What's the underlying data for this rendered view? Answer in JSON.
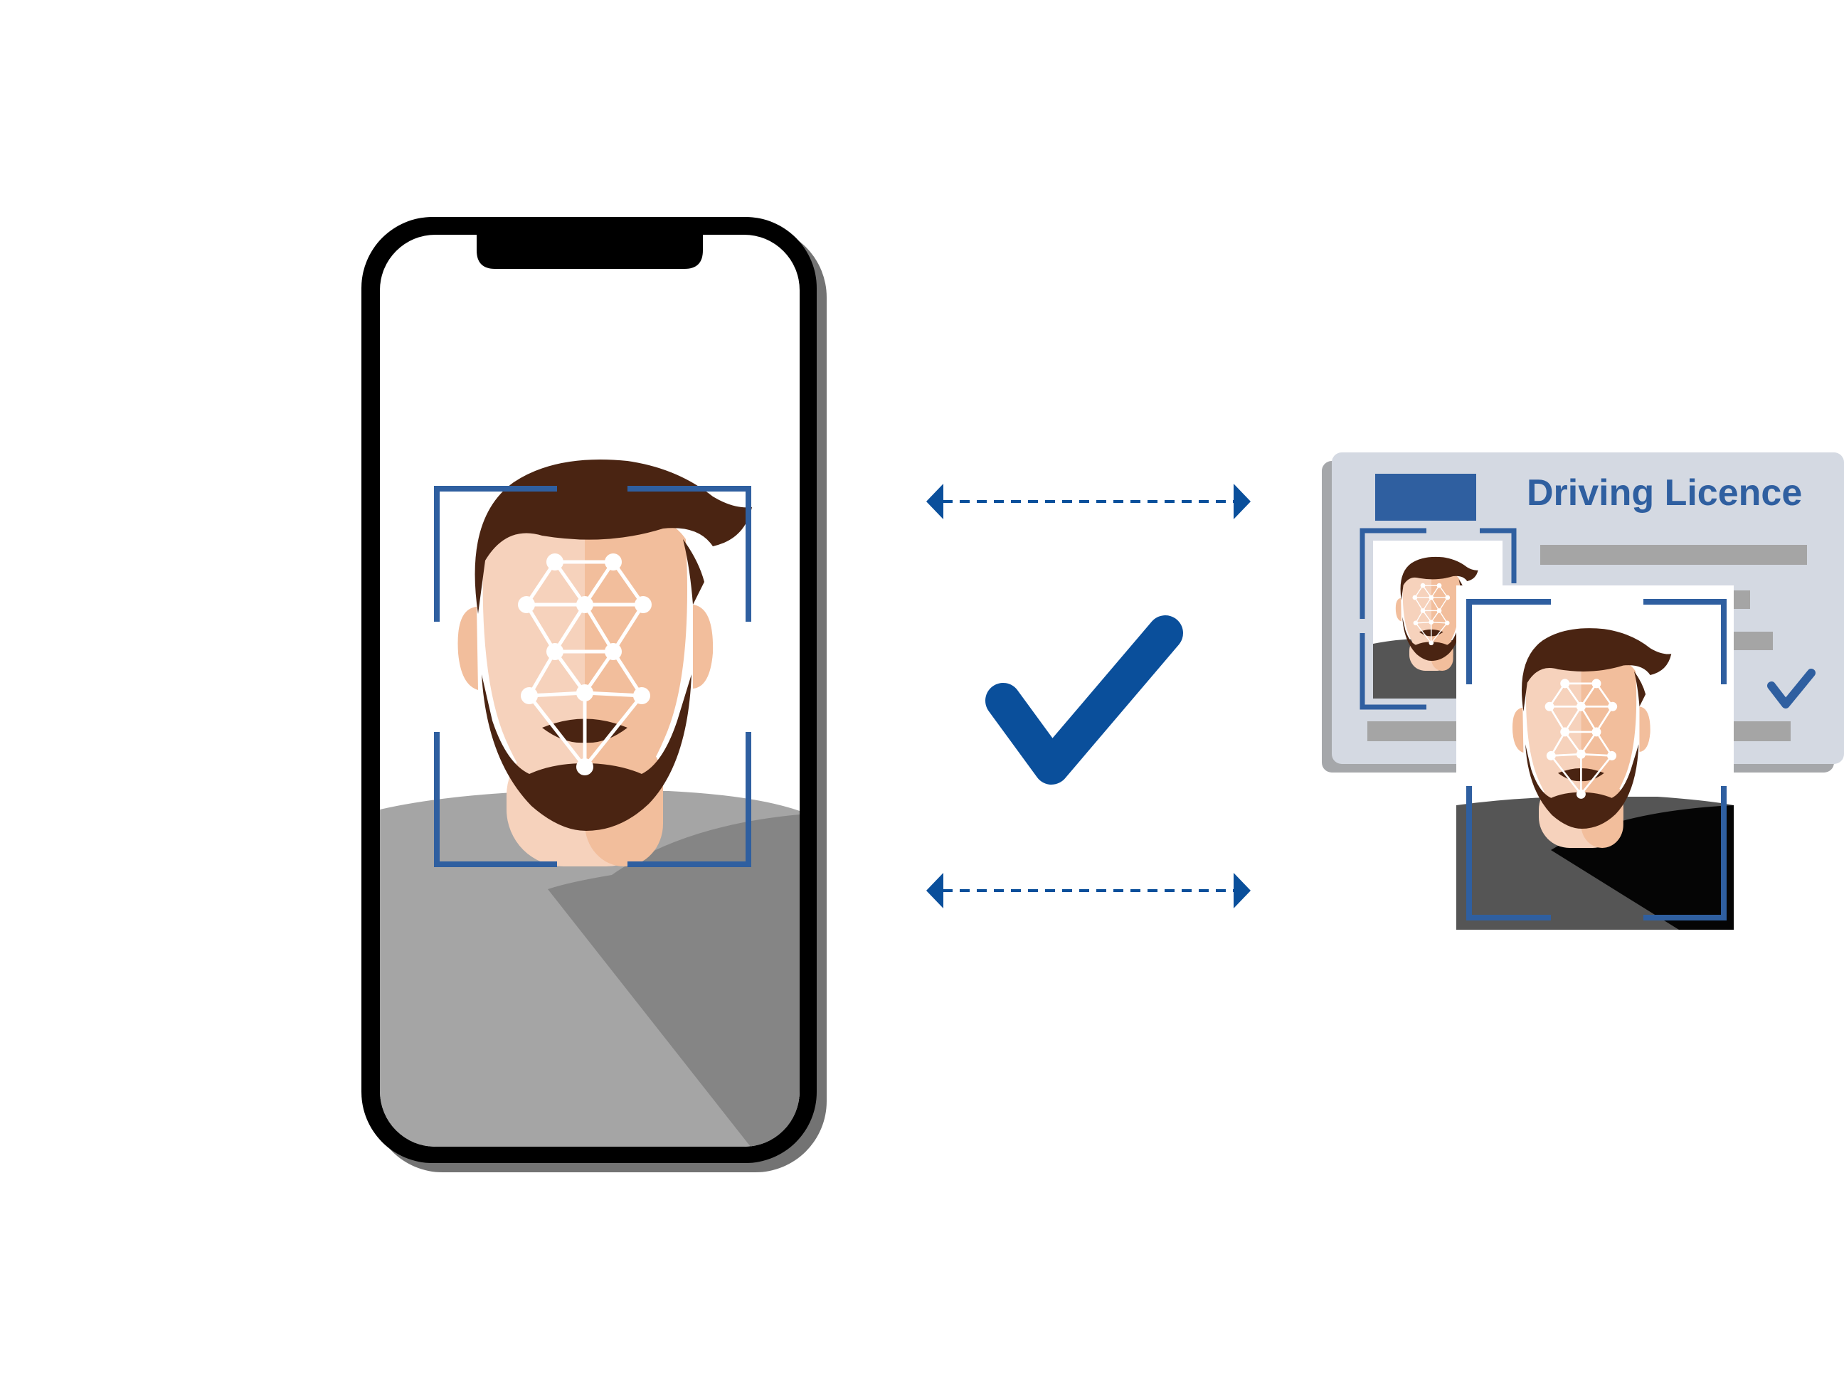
{
  "licence": {
    "title": "Driving Licence"
  },
  "colors": {
    "accent_blue": "#2F5FA0",
    "check_blue": "#0A4F9B",
    "card_background": "#D4D9E2",
    "card_shadow": "#A5A7AA",
    "hair_beard": "#4A2412",
    "skin_light": "#F6D2BC",
    "skin_dark": "#F2BE9C",
    "shirt_light": "#A5A5A5",
    "shirt_dark": "#858585",
    "phone_frame": "#000000"
  },
  "icons": {
    "phone": "smartphone-icon",
    "face_scan": "face-scan-icon",
    "match": "checkmark-icon",
    "exchange_top": "double-arrow-icon",
    "exchange_bottom": "double-arrow-icon",
    "document": "id-card-icon"
  }
}
